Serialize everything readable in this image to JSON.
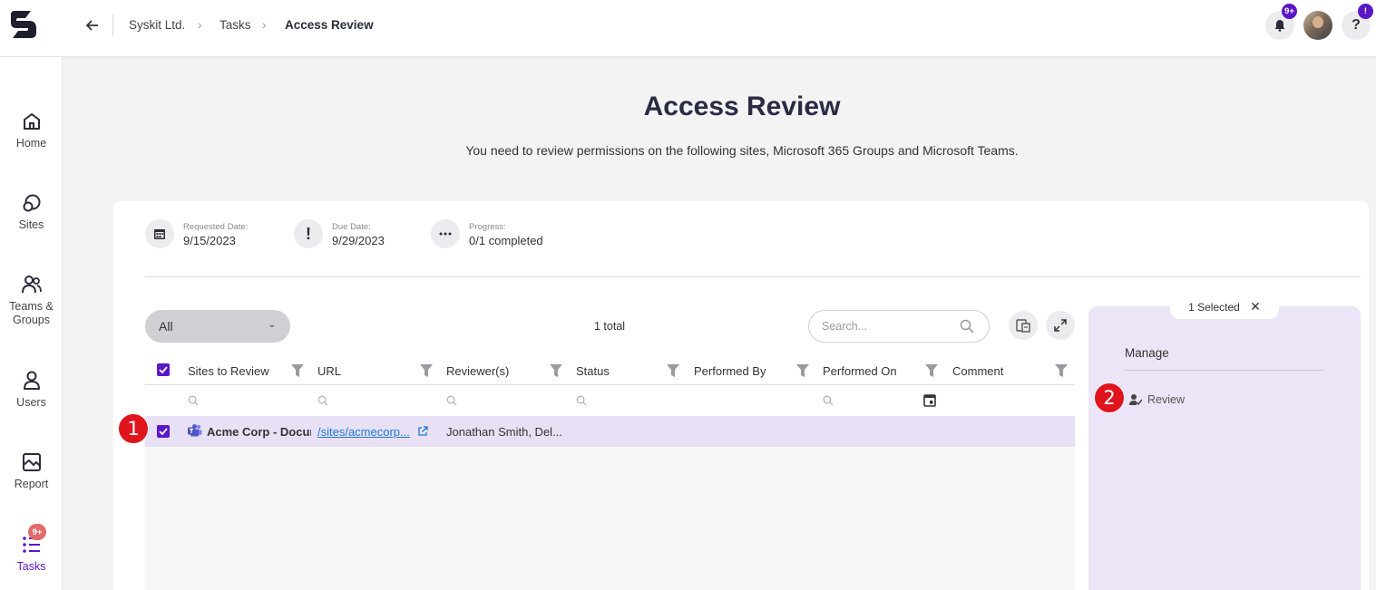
{
  "breadcrumb": [
    "Syskit Ltd.",
    "Tasks",
    "Access Review"
  ],
  "breadcrumb_separator": "›",
  "notifications_badge": "9+",
  "help_label": "?",
  "help_badge": "!",
  "sidebar": {
    "items": [
      {
        "label": "Home",
        "icon": "home-icon"
      },
      {
        "label": "Sites",
        "icon": "sites-icon"
      },
      {
        "label": "Teams & Groups",
        "icon": "teams-groups-icon"
      },
      {
        "label": "Users",
        "icon": "user-icon"
      },
      {
        "label": "Report",
        "icon": "report-icon"
      },
      {
        "label": "Tasks",
        "icon": "tasks-icon",
        "badge": "9+",
        "active": true
      }
    ]
  },
  "page": {
    "title": "Access Review",
    "subtitle": "You need to review permissions on the following sites, Microsoft 365 Groups and Microsoft Teams."
  },
  "meta": {
    "requested": {
      "label": "Requested Date:",
      "value": "9/15/2023"
    },
    "due": {
      "label": "Due Date:",
      "value": "9/29/2023"
    },
    "progress": {
      "label": "Progress:",
      "value": "0/1 completed"
    }
  },
  "toolbar": {
    "filter_value": "All",
    "total_text": "1 total",
    "search_placeholder": "Search..."
  },
  "table": {
    "columns": [
      "Sites to Review",
      "URL",
      "Reviewer(s)",
      "Status",
      "Performed By",
      "Performed On",
      "Comment"
    ],
    "rows": [
      {
        "site": "Acme Corp - Documents",
        "url": "/sites/acmecorp...",
        "reviewers": "Jonathan Smith, Del...",
        "status": "",
        "performed_by": "",
        "performed_on": "",
        "comment": "",
        "selected": true
      }
    ]
  },
  "panel": {
    "selected_text": "1 Selected",
    "close_label": "✕",
    "section_title": "Manage",
    "review_label": "Review"
  },
  "callouts": [
    "1",
    "2"
  ],
  "colors": {
    "accent": "#5b16c8",
    "selected_row": "#e8e0f4",
    "panel": "#ece4f7",
    "callout": "#e0141d",
    "link": "#1e7ad8"
  }
}
